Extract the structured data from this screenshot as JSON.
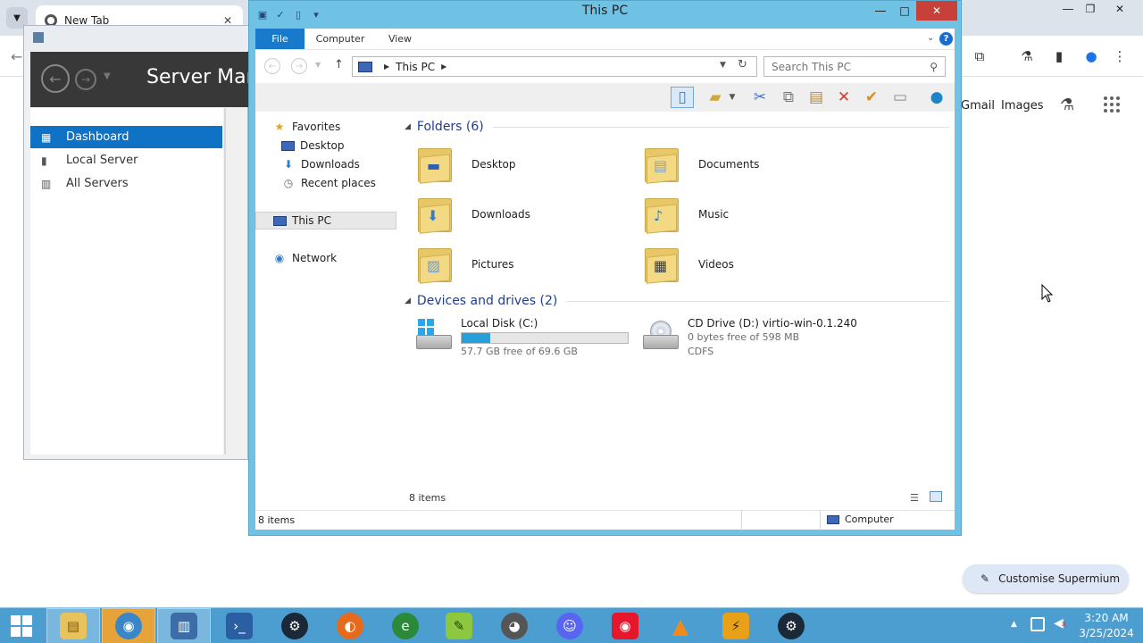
{
  "browser": {
    "tab_title": "New Tab",
    "links": {
      "gmail": "Gmail",
      "images": "Images"
    },
    "customise_label": "Customise Supermium"
  },
  "server_manager": {
    "title": "Server Manager",
    "nav": [
      {
        "label": "Dashboard",
        "selected": true
      },
      {
        "label": "Local Server",
        "selected": false
      },
      {
        "label": "All Servers",
        "selected": false
      }
    ]
  },
  "explorer": {
    "title": "This PC",
    "ribbon_tabs": [
      "File",
      "Computer",
      "View"
    ],
    "breadcrumb": "This PC",
    "search_placeholder": "Search This PC",
    "nav_pane": {
      "favorites": "Favorites",
      "desktop": "Desktop",
      "downloads": "Downloads",
      "recent": "Recent places",
      "this_pc": "This PC",
      "network": "Network"
    },
    "folders_header": "Folders (6)",
    "folders": [
      {
        "name": "Desktop"
      },
      {
        "name": "Documents"
      },
      {
        "name": "Downloads"
      },
      {
        "name": "Music"
      },
      {
        "name": "Pictures"
      },
      {
        "name": "Videos"
      }
    ],
    "devices_header": "Devices and drives (2)",
    "drives": [
      {
        "name": "Local Disk (C:)",
        "free": "57.7 GB free of 69.6 GB",
        "used_fraction": 0.171
      },
      {
        "name": "CD Drive (D:) virtio-win-0.1.240",
        "free": "0 bytes free of 598 MB",
        "fs": "CDFS"
      }
    ],
    "content_status": "8 items",
    "status_left": "8 items",
    "status_location": "Computer"
  },
  "taskbar": {
    "apps": [
      "file-explorer",
      "chrome",
      "server-manager",
      "powershell",
      "steam",
      "firefox",
      "internet-explorer",
      "notepad-plus-plus",
      "raccoon-app",
      "discord",
      "weibo",
      "vlc",
      "winamp",
      "steam"
    ]
  },
  "clock": {
    "time": "3:20 AM",
    "date": "3/25/2024"
  },
  "colors": {
    "explorer_frame": "#6fc2e4",
    "file_tab": "#1979ca",
    "sm_selected": "#0f72c5",
    "taskbar": "#4c9ed1",
    "capacity_fill": "#26a0da"
  }
}
